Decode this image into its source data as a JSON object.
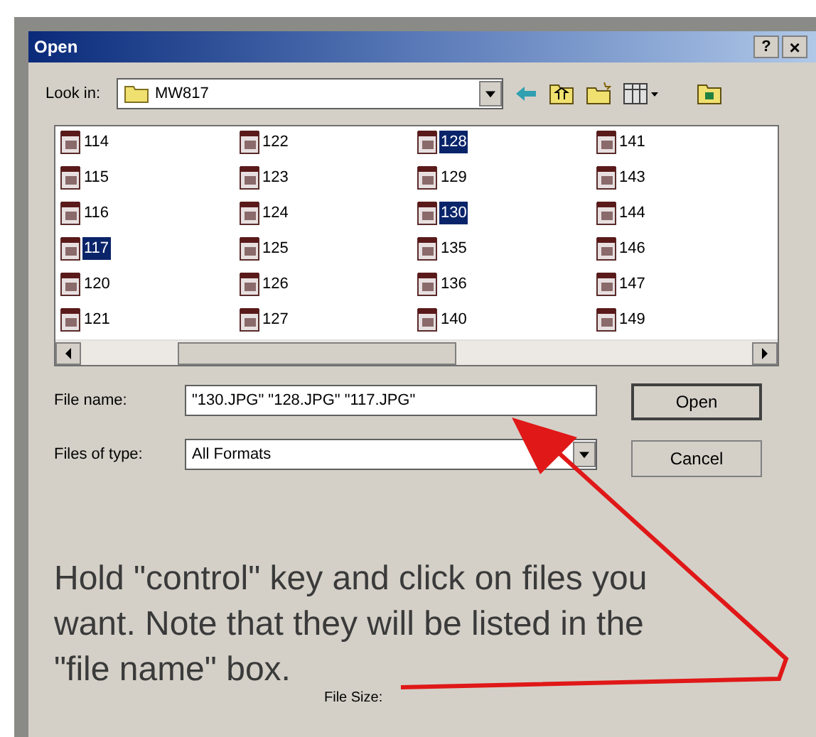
{
  "window": {
    "title": "Open",
    "help_button": "?",
    "close_button": "×"
  },
  "look_in": {
    "label": "Look in:",
    "value": "MW817"
  },
  "files": [
    {
      "name": "114",
      "selected": false
    },
    {
      "name": "115",
      "selected": false
    },
    {
      "name": "116",
      "selected": false
    },
    {
      "name": "117",
      "selected": true
    },
    {
      "name": "120",
      "selected": false
    },
    {
      "name": "121",
      "selected": false
    },
    {
      "name": "122",
      "selected": false
    },
    {
      "name": "123",
      "selected": false
    },
    {
      "name": "124",
      "selected": false
    },
    {
      "name": "125",
      "selected": false
    },
    {
      "name": "126",
      "selected": false
    },
    {
      "name": "127",
      "selected": false
    },
    {
      "name": "128",
      "selected": true
    },
    {
      "name": "129",
      "selected": false
    },
    {
      "name": "130",
      "selected": true
    },
    {
      "name": "135",
      "selected": false
    },
    {
      "name": "136",
      "selected": false
    },
    {
      "name": "140",
      "selected": false
    },
    {
      "name": "141",
      "selected": false
    },
    {
      "name": "143",
      "selected": false
    },
    {
      "name": "144",
      "selected": false
    },
    {
      "name": "146",
      "selected": false
    },
    {
      "name": "147",
      "selected": false
    },
    {
      "name": "149",
      "selected": false
    }
  ],
  "file_name": {
    "label": "File name:",
    "value": "\"130.JPG\" \"128.JPG\" \"117.JPG\""
  },
  "file_type": {
    "label": "Files of type:",
    "value": "All Formats"
  },
  "buttons": [
    "Open",
    "Cancel"
  ],
  "annotation": "Hold \"control\" key and click on files you want. Note that they will be listed in the \"file name\" box.",
  "file_size_label": "File Size:"
}
